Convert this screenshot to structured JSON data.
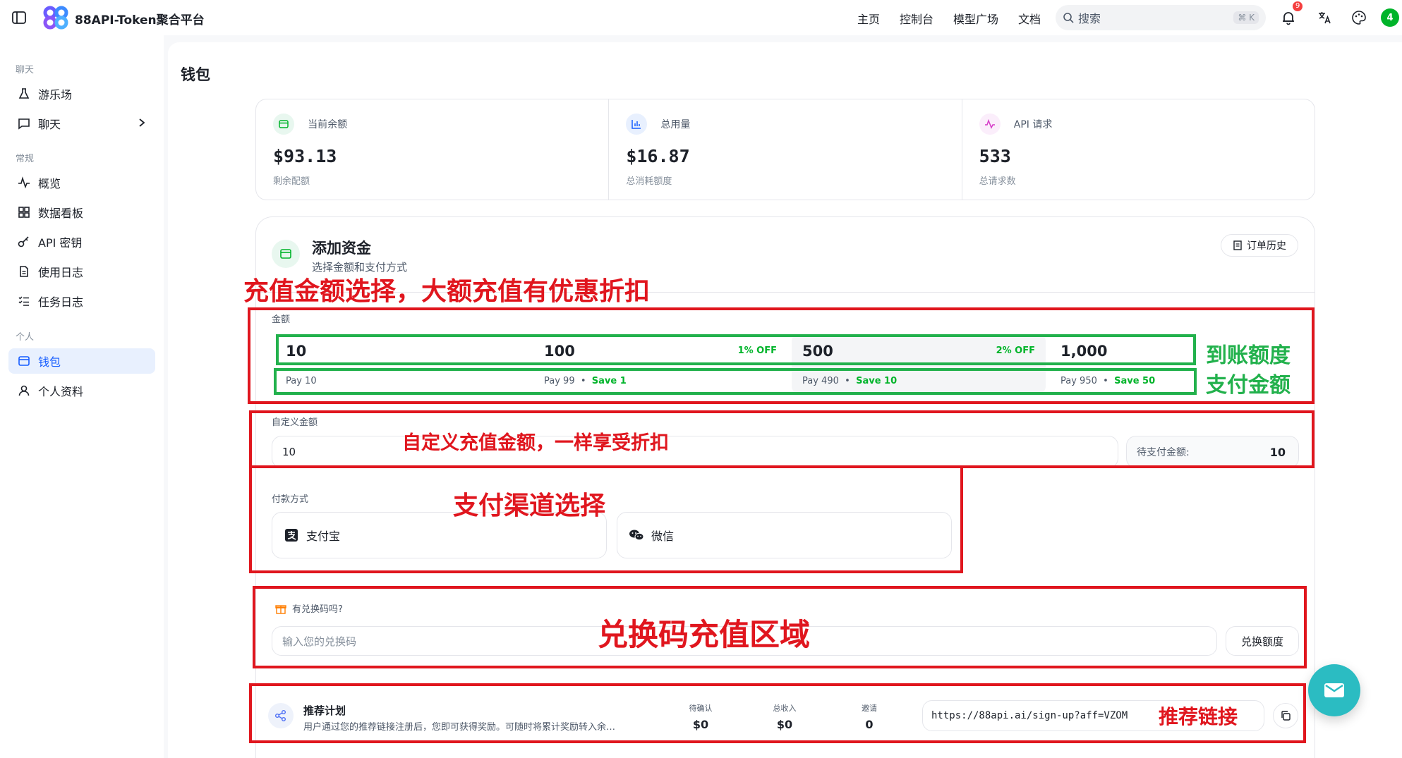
{
  "header": {
    "brand": "88API-Token聚合平台",
    "nav": [
      "主页",
      "控制台",
      "模型广场",
      "文档"
    ],
    "search_placeholder": "搜索",
    "search_shortcut": "⌘ K",
    "notification_count": "9",
    "avatar_letter": "4"
  },
  "sidebar": {
    "sections": [
      {
        "title": "聊天",
        "items": [
          {
            "label": "游乐场",
            "icon": "flask-icon"
          },
          {
            "label": "聊天",
            "icon": "chat-icon"
          }
        ]
      },
      {
        "title": "常规",
        "items": [
          {
            "label": "概览",
            "icon": "activity-icon"
          },
          {
            "label": "数据看板",
            "icon": "dashboard-icon"
          },
          {
            "label": "API 密钥",
            "icon": "key-icon"
          },
          {
            "label": "使用日志",
            "icon": "file-icon"
          },
          {
            "label": "任务日志",
            "icon": "list-icon"
          }
        ]
      },
      {
        "title": "个人",
        "items": [
          {
            "label": "钱包",
            "icon": "wallet-icon"
          },
          {
            "label": "个人资料",
            "icon": "user-icon"
          }
        ]
      }
    ]
  },
  "page": {
    "title": "钱包"
  },
  "stats": [
    {
      "label": "当前余额",
      "value": "$93.13",
      "sub": "剩余配额",
      "icon": "wallet-icon"
    },
    {
      "label": "总用量",
      "value": "$16.87",
      "sub": "总消耗额度",
      "icon": "bar-chart-icon"
    },
    {
      "label": "API 请求",
      "value": "533",
      "sub": "总请求数",
      "icon": "pulse-icon"
    }
  ],
  "funds": {
    "title": "添加资金",
    "subtitle": "选择金额和支付方式",
    "order_history": "订单历史",
    "amount_label": "金额",
    "amounts": [
      {
        "value": "10",
        "off": "",
        "pay": "Pay 10",
        "save": ""
      },
      {
        "value": "100",
        "off": "1% OFF",
        "pay": "Pay 99",
        "save": "Save 1"
      },
      {
        "value": "500",
        "off": "2% OFF",
        "pay": "Pay 490",
        "save": "Save 10"
      },
      {
        "value": "1,000",
        "off": "",
        "pay": "Pay 950",
        "save": "Save 50"
      }
    ],
    "custom_label": "自定义金额",
    "custom_value": "10",
    "to_pay_label": "待支付金额:",
    "to_pay_value": "10",
    "payment_label": "付款方式",
    "payment_methods": [
      "支付宝",
      "微信"
    ],
    "redeem_label": "有兑换码吗?",
    "redeem_placeholder": "输入您的兑换码",
    "redeem_button": "兑换额度"
  },
  "referral": {
    "title": "推荐计划",
    "desc": "用户通过您的推荐链接注册后，您即可获得奖励。可随时将累计奖励转入余…",
    "stats": [
      {
        "label": "待确认",
        "value": "$0"
      },
      {
        "label": "总收入",
        "value": "$0"
      },
      {
        "label": "邀请",
        "value": "0"
      }
    ],
    "link": "https://88api.ai/sign-up?aff=VZOM"
  },
  "annotations": {
    "amount": "充值金额选择，大额充值有优惠折扣",
    "credited": "到账额度",
    "paid": "支付金额",
    "custom": "自定义充值金额，一样享受折扣",
    "payment": "支付渠道选择",
    "redeem": "兑换码充值区域",
    "referral": "推荐链接"
  },
  "colors": {
    "accent": "#165dff",
    "annotation_red": "#e0161e",
    "annotation_green": "#22b14c",
    "fab": "#2bbcc2"
  }
}
